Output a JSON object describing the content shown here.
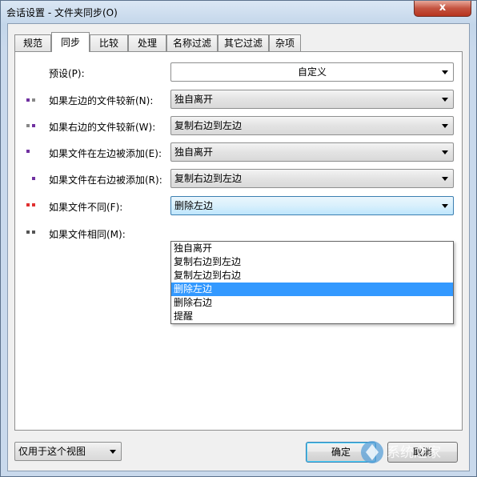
{
  "window": {
    "title": "会话设置 - 文件夹同步(O)",
    "close_glyph": "x"
  },
  "tabs": [
    "规范",
    "同步",
    "比较",
    "处理",
    "名称过滤",
    "其它过滤",
    "杂项"
  ],
  "active_tab": "同步",
  "preset": {
    "label": "预设(P):",
    "value": "自定义"
  },
  "rules": [
    {
      "label": "如果左边的文件较新(N):",
      "value": "独自离开",
      "dot_colors": [
        "#7030a0",
        "#888888"
      ]
    },
    {
      "label": "如果右边的文件较新(W):",
      "value": "复制右边到左边",
      "dot_colors": [
        "#888888",
        "#7030a0"
      ]
    },
    {
      "label": "如果文件在左边被添加(E):",
      "value": "独自离开",
      "dot_colors": [
        "#7030a0"
      ]
    },
    {
      "label": "如果文件在右边被添加(R):",
      "value": "复制右边到左边",
      "dot_colors": [
        "#7030a0"
      ]
    },
    {
      "label": "如果文件不同(F):",
      "value": "删除左边",
      "dot_colors": [
        "#e03030",
        "#e03030"
      ]
    },
    {
      "label": "如果文件相同(M):",
      "value": "",
      "dot_colors": [
        "#555555",
        "#555555"
      ]
    }
  ],
  "dropdown": {
    "options": [
      "独自离开",
      "复制右边到左边",
      "复制左边到右边",
      "删除左边",
      "删除右边",
      "提醒"
    ],
    "selected": "删除左边"
  },
  "footer": {
    "view_scope": "仅用于这个视图",
    "ok_label": "确定",
    "cancel_label": "取消",
    "watermark_text": "系统之家"
  }
}
